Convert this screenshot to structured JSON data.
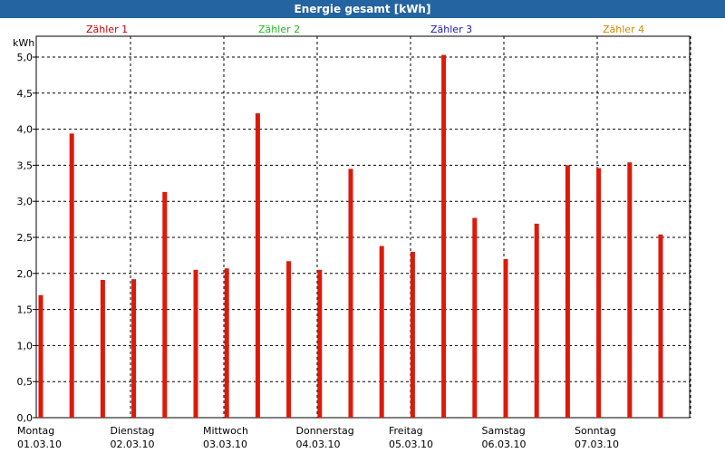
{
  "window": {
    "title": "Energie gesamt [kWh]"
  },
  "chart_data": {
    "type": "bar",
    "title": "Energie gesamt [kWh]",
    "ylabel": "kWh",
    "ylim": [
      0,
      5.0
    ],
    "yticks": [
      "0,0",
      "0,5",
      "1,0",
      "1,5",
      "2,0",
      "2,5",
      "3,0",
      "3,5",
      "4,0",
      "4,5",
      "5,0"
    ],
    "grid": true,
    "legend_placement": "top",
    "legend": [
      {
        "label": "Zähler 1",
        "color": "#cc0000"
      },
      {
        "label": "Zähler 2",
        "color": "#22bb22"
      },
      {
        "label": "Zähler 3",
        "color": "#1a1aaa"
      },
      {
        "label": "Zähler 4",
        "color": "#d08a00"
      }
    ],
    "days": [
      {
        "day": "Montag",
        "date": "01.03.10"
      },
      {
        "day": "Dienstag",
        "date": "02.03.10"
      },
      {
        "day": "Mittwoch",
        "date": "03.03.10"
      },
      {
        "day": "Donnerstag",
        "date": "04.03.10"
      },
      {
        "day": "Freitag",
        "date": "05.03.10"
      },
      {
        "day": "Samstag",
        "date": "06.03.10"
      },
      {
        "day": "Sonntag",
        "date": "07.03.10"
      }
    ],
    "bar_color": "#dd1a0a",
    "values": [
      1.7,
      3.94,
      1.91,
      1.92,
      3.13,
      2.05,
      2.07,
      4.22,
      2.17,
      2.05,
      3.45,
      2.38,
      2.3,
      5.03,
      2.77,
      2.2,
      2.69,
      3.5,
      3.46,
      3.54,
      2.54
    ]
  }
}
